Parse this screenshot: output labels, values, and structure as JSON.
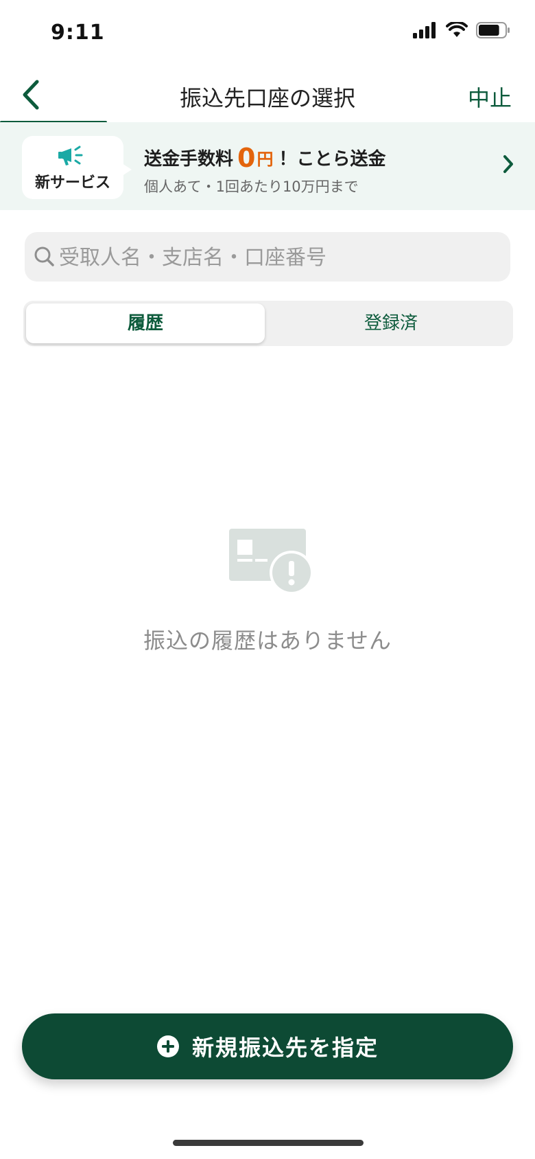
{
  "status_bar": {
    "time": "9:11",
    "battery_level": 0.8
  },
  "nav": {
    "title": "振込先口座の選択",
    "cancel_label": "中止"
  },
  "banner": {
    "badge_label": "新サービス",
    "title_prefix": "送金手数料",
    "title_amount": "0",
    "title_currency": "円",
    "title_suffix": "！ことら送金",
    "subtitle": "個人あて・1回あたり10万円まで",
    "accent_color": "#e3640c"
  },
  "search": {
    "placeholder": "受取人名・支店名・口座番号",
    "value": ""
  },
  "tabs": [
    {
      "label": "履歴",
      "selected": true
    },
    {
      "label": "登録済",
      "selected": false
    }
  ],
  "empty_state": {
    "message": "振込の履歴はありません",
    "icon": "card-alert-icon"
  },
  "primary_action": {
    "label": "新規振込先を指定",
    "icon": "plus-circle-icon"
  },
  "colors": {
    "brand": "#0d5b3c",
    "button": "#0d4a34",
    "banner_bg": "#eff6f3"
  }
}
